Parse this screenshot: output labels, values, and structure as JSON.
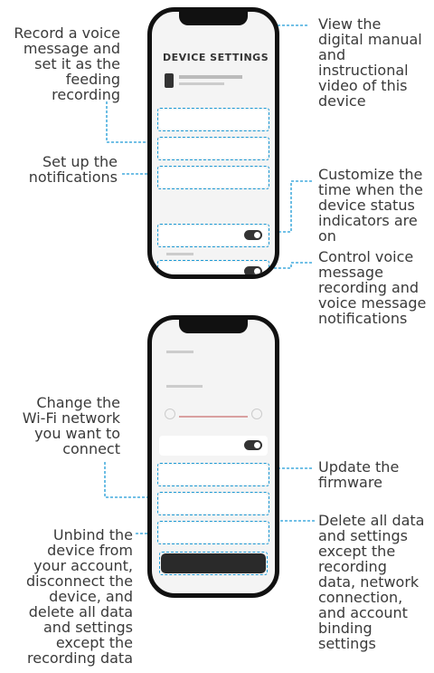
{
  "callouts": {
    "record_voice": [
      "Record a voice",
      "message and",
      "set it as the",
      "feeding",
      "recording"
    ],
    "notifications": [
      "Set up the",
      "notifications"
    ],
    "manual": [
      "View the",
      "digital manual",
      "and",
      "instructional",
      "video of this",
      "device"
    ],
    "indicator_time": [
      "Customize the",
      "time when the",
      "device status",
      "indicators are",
      "on"
    ],
    "voice_control": [
      "Control voice",
      "message",
      "recording and",
      "voice message",
      "notifications"
    ],
    "wifi": [
      "Change the",
      "Wi-Fi network",
      "you want to",
      "connect"
    ],
    "firmware": [
      "Update the",
      "firmware"
    ],
    "unbind": [
      "Unbind the",
      "device from",
      "your account,",
      "disconnect the",
      "device, and",
      "delete all data",
      "and settings",
      "except the",
      "recording data"
    ],
    "reset": [
      "Delete all data",
      "and settings",
      "except the",
      "recording",
      "data, network",
      "connection,",
      "and account",
      "binding",
      "settings"
    ]
  },
  "screen1": {
    "title": "DEVICE SETTINGS"
  },
  "colors": {
    "accent": "#1d9ad6",
    "phone_frame": "#111111",
    "screen_bg": "#f4f4f4"
  }
}
